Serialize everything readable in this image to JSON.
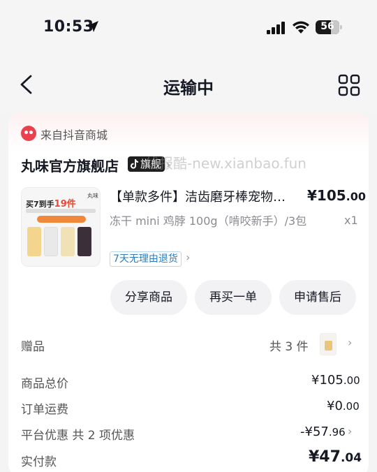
{
  "status_bar": {
    "time": "10:53",
    "battery": "56"
  },
  "nav": {
    "title": "运输中"
  },
  "order": {
    "source": "来自抖音商城",
    "store_name": "丸味官方旗舰店",
    "store_badge": "旗舰",
    "watermark": "线报酷-new.xianbao.fun",
    "product": {
      "title": "【单款多件】洁齿磨牙棒宠物…",
      "price_int": "¥105",
      "price_dec": ".00",
      "spec": "冻干 mini 鸡脖 100g（啃咬新手）/3包",
      "quantity": "x1",
      "return_tag": "7天无理由退货",
      "thumb_text_a": "买7到手",
      "thumb_text_b": "19件",
      "thumb_brand": "丸味"
    },
    "actions": [
      "分享商品",
      "再买一单",
      "申请售后"
    ]
  },
  "summary": {
    "gift_label": "赠品",
    "gift_count": "共 3 件",
    "total_label": "商品总价",
    "total_int": "¥105",
    "total_dec": ".00",
    "shipping_label": "订单运费",
    "shipping_int": "¥0",
    "shipping_dec": ".00",
    "discount_label": "平台优惠  共 2 项优惠",
    "discount_int": "-¥57",
    "discount_dec": ".96",
    "paid_label": "实付款",
    "paid_int": "¥47",
    "paid_dec": ".04"
  }
}
